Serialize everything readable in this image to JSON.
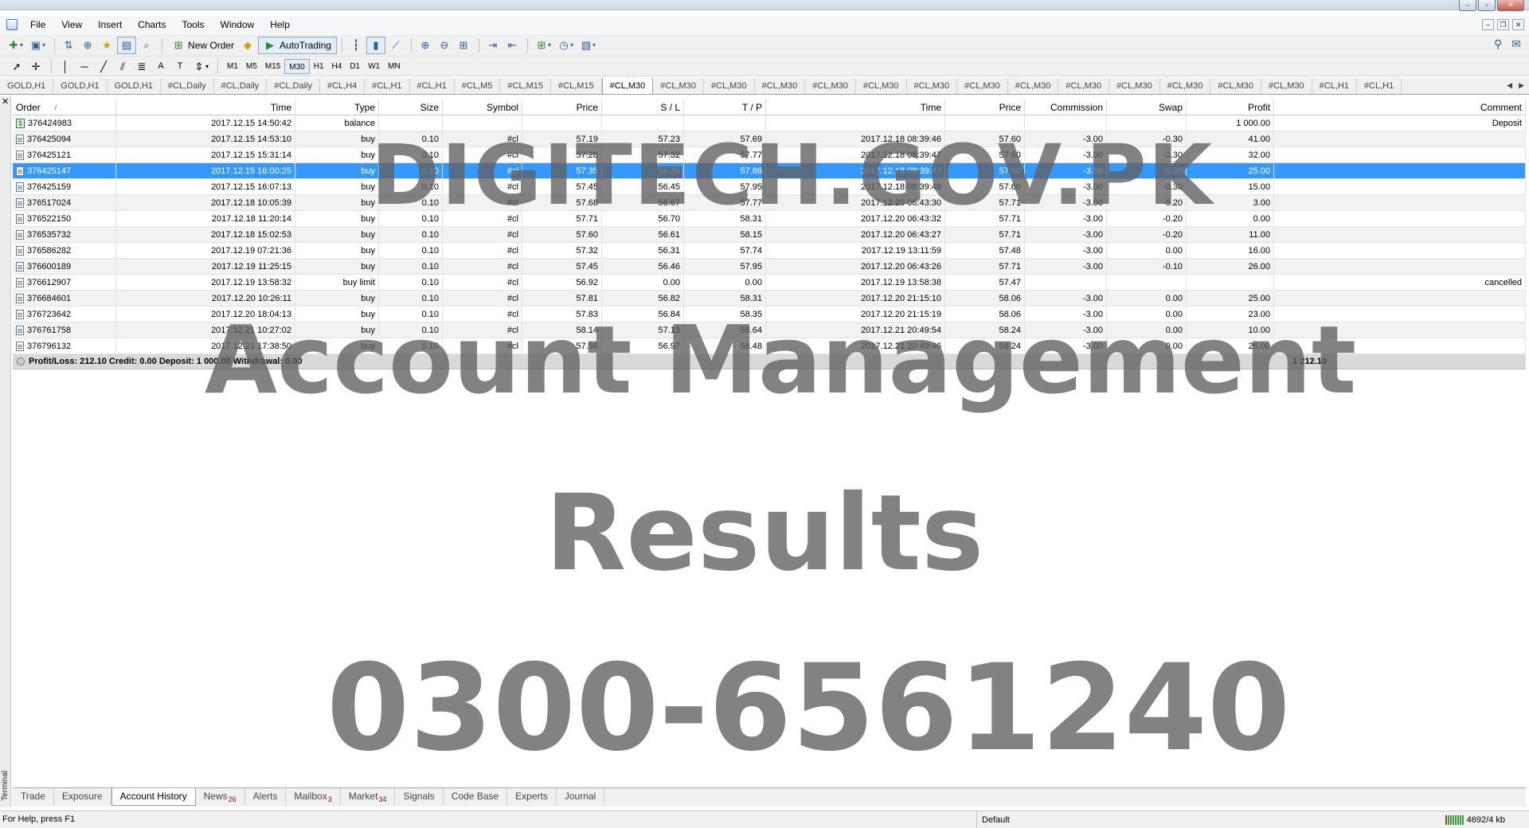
{
  "window": {
    "controls": [
      "minimize",
      "restore",
      "close"
    ],
    "mdi_controls": [
      "minimize",
      "restore",
      "close"
    ]
  },
  "menu": [
    "File",
    "View",
    "Insert",
    "Charts",
    "Tools",
    "Window",
    "Help"
  ],
  "toolbar": {
    "new_order_label": "New Order",
    "autotrading_label": "AutoTrading",
    "timeframes": [
      "M1",
      "M5",
      "M15",
      "M30",
      "H1",
      "H4",
      "D1",
      "W1",
      "MN"
    ],
    "active_timeframe": "M30"
  },
  "chart_tabs": [
    "GOLD,H1",
    "GOLD,H1",
    "GOLD,H1",
    "#CL,Daily",
    "#CL,Daily",
    "#CL,Daily",
    "#CL,H4",
    "#CL,H1",
    "#CL,H1",
    "#CL,M5",
    "#CL,M15",
    "#CL,M15",
    "#CL,M30",
    "#CL,M30",
    "#CL,M30",
    "#CL,M30",
    "#CL,M30",
    "#CL,M30",
    "#CL,M30",
    "#CL,M30",
    "#CL,M30",
    "#CL,M30",
    "#CL,M30",
    "#CL,M30",
    "#CL,M30",
    "#CL,M30",
    "#CL,H1",
    "#CL,H1"
  ],
  "active_chart_tab_index": 12,
  "columns": [
    "Order",
    "Time",
    "Type",
    "Size",
    "Symbol",
    "Price",
    "S / L",
    "T / P",
    "Time",
    "Price",
    "Commission",
    "Swap",
    "Profit",
    "Comment"
  ],
  "sort_indicator": "/",
  "rows": [
    {
      "order": "376424983",
      "time": "2017.12.15 14:50:42",
      "type": "balance",
      "size": "",
      "symbol": "",
      "price": "",
      "sl": "",
      "tp": "",
      "close_time": "",
      "close_price": "",
      "commission": "",
      "swap": "",
      "profit": "1 000.00",
      "comment": "Deposit",
      "icon": "balance"
    },
    {
      "order": "376425094",
      "time": "2017.12.15 14:53:10",
      "type": "buy",
      "size": "0.10",
      "symbol": "#cl",
      "price": "57.19",
      "sl": "57.23",
      "tp": "57.69",
      "close_time": "2017.12.18 08:39:46",
      "close_price": "57.60",
      "commission": "-3.00",
      "swap": "-0.30",
      "profit": "41.00",
      "comment": "",
      "icon": "order"
    },
    {
      "order": "376425121",
      "time": "2017.12.15 15:31:14",
      "type": "buy",
      "size": "0.10",
      "symbol": "#cl",
      "price": "57.28",
      "sl": "57.32",
      "tp": "57.77",
      "close_time": "2017.12.18 08:39:47",
      "close_price": "57.60",
      "commission": "-3.00",
      "swap": "-0.30",
      "profit": "32.00",
      "comment": "",
      "icon": "order"
    },
    {
      "order": "376425147",
      "time": "2017.12.15 16:00:25",
      "type": "buy",
      "size": "0.10",
      "symbol": "#cl",
      "price": "57.35",
      "sl": "56.35",
      "tp": "57.86",
      "close_time": "2017.12.18 08:39:47",
      "close_price": "57.60",
      "commission": "-3.00",
      "swap": "-0.30",
      "profit": "25.00",
      "comment": "",
      "icon": "order",
      "selected": true
    },
    {
      "order": "376425159",
      "time": "2017.12.15 16:07:13",
      "type": "buy",
      "size": "0.10",
      "symbol": "#cl",
      "price": "57.45",
      "sl": "56.45",
      "tp": "57.95",
      "close_time": "2017.12.18 08:39:48",
      "close_price": "57.60",
      "commission": "-3.00",
      "swap": "-0.30",
      "profit": "15.00",
      "comment": "",
      "icon": "order"
    },
    {
      "order": "376517024",
      "time": "2017.12.18 10:05:39",
      "type": "buy",
      "size": "0.10",
      "symbol": "#cl",
      "price": "57.68",
      "sl": "56.67",
      "tp": "57.77",
      "close_time": "2017.12.20 06:43:30",
      "close_price": "57.71",
      "commission": "-3.00",
      "swap": "-0.20",
      "profit": "3.00",
      "comment": "",
      "icon": "order"
    },
    {
      "order": "376522150",
      "time": "2017.12.18 11:20:14",
      "type": "buy",
      "size": "0.10",
      "symbol": "#cl",
      "price": "57.71",
      "sl": "56.70",
      "tp": "58.31",
      "close_time": "2017.12.20 06:43:32",
      "close_price": "57.71",
      "commission": "-3.00",
      "swap": "-0.20",
      "profit": "0.00",
      "comment": "",
      "icon": "order"
    },
    {
      "order": "376535732",
      "time": "2017.12.18 15:02:53",
      "type": "buy",
      "size": "0.10",
      "symbol": "#cl",
      "price": "57.60",
      "sl": "56.61",
      "tp": "58.15",
      "close_time": "2017.12.20 06:43:27",
      "close_price": "57.71",
      "commission": "-3.00",
      "swap": "-0.20",
      "profit": "11.00",
      "comment": "",
      "icon": "order"
    },
    {
      "order": "376586282",
      "time": "2017.12.19 07:21:36",
      "type": "buy",
      "size": "0.10",
      "symbol": "#cl",
      "price": "57.32",
      "sl": "56.31",
      "tp": "57.74",
      "close_time": "2017.12.19 13:11:59",
      "close_price": "57.48",
      "commission": "-3.00",
      "swap": "0.00",
      "profit": "16.00",
      "comment": "",
      "icon": "order"
    },
    {
      "order": "376600189",
      "time": "2017.12.19 11:25:15",
      "type": "buy",
      "size": "0.10",
      "symbol": "#cl",
      "price": "57.45",
      "sl": "56.46",
      "tp": "57.95",
      "close_time": "2017.12.20 06:43:26",
      "close_price": "57.71",
      "commission": "-3.00",
      "swap": "-0.10",
      "profit": "26.00",
      "comment": "",
      "icon": "order"
    },
    {
      "order": "376612907",
      "time": "2017.12.19 13:58:32",
      "type": "buy limit",
      "size": "0.10",
      "symbol": "#cl",
      "price": "56.92",
      "sl": "0.00",
      "tp": "0.00",
      "close_time": "2017.12.19 13:58:38",
      "close_price": "57.47",
      "commission": "",
      "swap": "",
      "profit": "",
      "comment": "cancelled",
      "icon": "order"
    },
    {
      "order": "376684601",
      "time": "2017.12.20 10:26:11",
      "type": "buy",
      "size": "0.10",
      "symbol": "#cl",
      "price": "57.81",
      "sl": "56.82",
      "tp": "58.31",
      "close_time": "2017.12.20 21:15:10",
      "close_price": "58.06",
      "commission": "-3.00",
      "swap": "0.00",
      "profit": "25.00",
      "comment": "",
      "icon": "order"
    },
    {
      "order": "376723642",
      "time": "2017.12.20 18:04:13",
      "type": "buy",
      "size": "0.10",
      "symbol": "#cl",
      "price": "57.83",
      "sl": "56.84",
      "tp": "58.35",
      "close_time": "2017.12.20 21:15:19",
      "close_price": "58.06",
      "commission": "-3.00",
      "swap": "0.00",
      "profit": "23.00",
      "comment": "",
      "icon": "order"
    },
    {
      "order": "376761758",
      "time": "2017.12.21 10:27:02",
      "type": "buy",
      "size": "0.10",
      "symbol": "#cl",
      "price": "58.14",
      "sl": "57.13",
      "tp": "58.64",
      "close_time": "2017.12.21 20:49:54",
      "close_price": "58.24",
      "commission": "-3.00",
      "swap": "0.00",
      "profit": "10.00",
      "comment": "",
      "icon": "order"
    },
    {
      "order": "376796132",
      "time": "2017.12.21 17:38:50",
      "type": "buy",
      "size": "0.10",
      "symbol": "#cl",
      "price": "57.98",
      "sl": "56.97",
      "tp": "58.48",
      "close_time": "2017.12.21 20:49:46",
      "close_price": "58.24",
      "commission": "-3.00",
      "swap": "0.00",
      "profit": "26.00",
      "comment": "",
      "icon": "order"
    }
  ],
  "summary": {
    "text": "Profit/Loss: 212.10   Credit: 0.00   Deposit: 1 000.00   Withdrawal: 0.00",
    "total": "1 212.10"
  },
  "watermark": {
    "line1": "DIGITECH.GOV.PK",
    "line2": "Account Management",
    "line3": "Results",
    "line4": "0300-6561240"
  },
  "terminal_label": "Terminal",
  "bottom_tabs": [
    {
      "label": "Trade",
      "badge": ""
    },
    {
      "label": "Exposure",
      "badge": ""
    },
    {
      "label": "Account History",
      "badge": ""
    },
    {
      "label": "News",
      "badge": "26"
    },
    {
      "label": "Alerts",
      "badge": ""
    },
    {
      "label": "Mailbox",
      "badge": "3"
    },
    {
      "label": "Market",
      "badge": "34"
    },
    {
      "label": "Signals",
      "badge": ""
    },
    {
      "label": "Code Base",
      "badge": ""
    },
    {
      "label": "Experts",
      "badge": ""
    },
    {
      "label": "Journal",
      "badge": ""
    }
  ],
  "active_bottom_tab": "Account History",
  "status": {
    "help": "For Help, press F1",
    "profile": "Default",
    "connection": "4692/4 kb"
  },
  "colors": {
    "selection": "#3399ff",
    "zebra": "#f2f2f2",
    "summary_bg": "#d9d9d9",
    "badge": "#c00000"
  }
}
